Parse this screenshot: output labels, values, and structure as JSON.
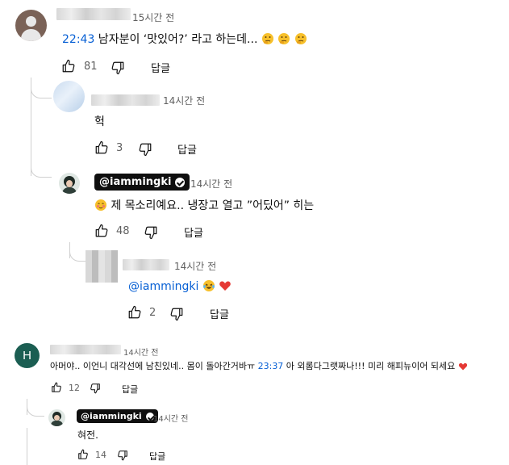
{
  "comments": [
    {
      "time": "15시간 전",
      "timestamp_link": "22:43",
      "text": " 남자분이 ‘맛있어?’ 라고 하는데...",
      "emoji_names": [
        "thinking-face",
        "thinking-face",
        "thinking-face"
      ],
      "likes": "81",
      "reply_label": "답글"
    },
    {
      "time": "14시간 전",
      "text": "헉",
      "likes": "3",
      "reply_label": "답글"
    },
    {
      "author": "@iammingki",
      "time": "14시간 전",
      "text": " 제 목소리예요.. 냉장고 열고 ”어딨어” 히는",
      "emoji_names": [
        "blushing-face"
      ],
      "likes": "48",
      "reply_label": "답글"
    },
    {
      "time": "14시간 전",
      "mention": "@iammingki",
      "emoji_names": [
        "laughing-tears-face",
        "red-heart"
      ],
      "likes": "2",
      "reply_label": "답글"
    },
    {
      "avatar_letter": "H",
      "time": "14시간 전",
      "text_a": "아머야.. 이언니 대각선에 남친있네.. 몸이 돌아간거바ㅠ ",
      "timestamp_link": "23:37",
      "text_b": " 아 외롬다그랫짜나!!! 미리 해피뉴이어 되세요",
      "emoji_names": [
        "red-heart"
      ],
      "likes": "12",
      "reply_label": "답글"
    },
    {
      "author": "@iammingki",
      "time": "14시간 전",
      "text": "혀전.",
      "likes": "14",
      "reply_label": "답글"
    }
  ],
  "colors": {
    "link": "#065fd4",
    "badge_bg": "#0f0f0f",
    "avatar_h": "#1b5e52",
    "heart": "#e53935"
  }
}
